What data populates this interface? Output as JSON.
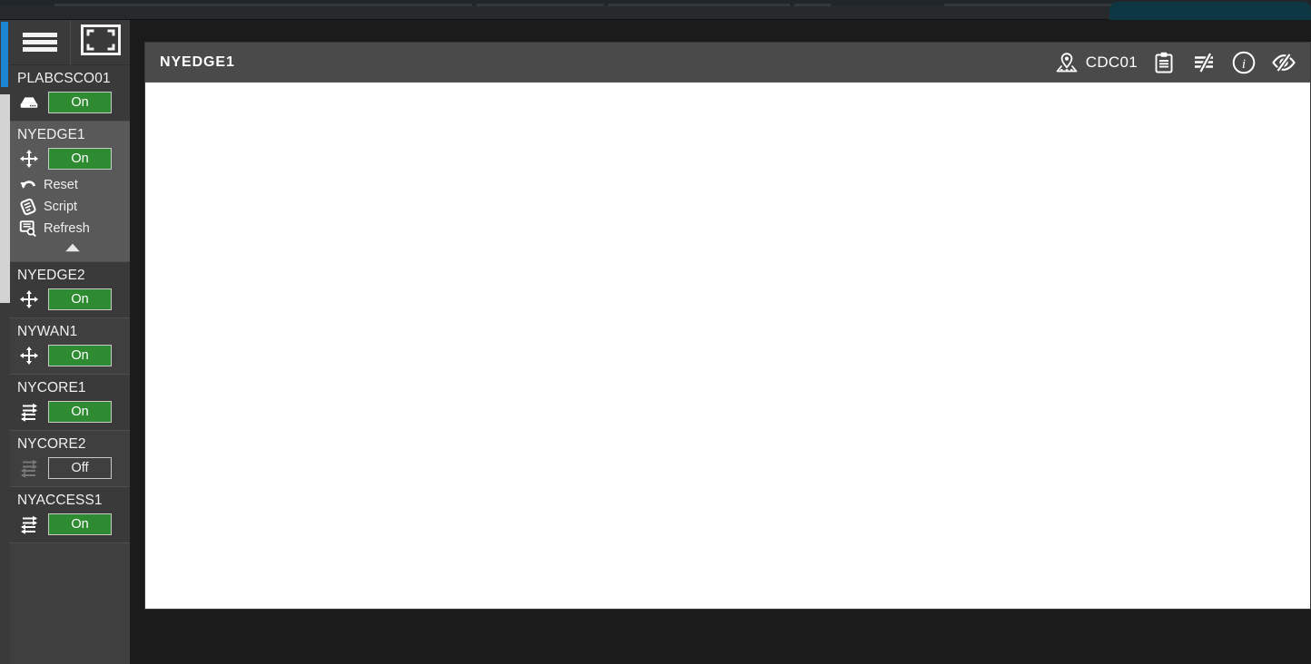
{
  "browser": {
    "tab_title": ""
  },
  "sidebar": {
    "toolbar": {
      "menu_label": "menu-toggle",
      "fullscreen_label": "fullscreen-toggle"
    },
    "devices": [
      {
        "name": "PLABCSCO01",
        "icon": "server-icon",
        "power_state": "On",
        "expanded": false,
        "actions": []
      },
      {
        "name": "NYEDGE1",
        "icon": "router-icon",
        "power_state": "On",
        "expanded": true,
        "actions": [
          {
            "label": "Reset",
            "icon": "undo-arrow-icon"
          },
          {
            "label": "Script",
            "icon": "scroll-icon"
          },
          {
            "label": "Refresh",
            "icon": "screen-search-icon"
          }
        ],
        "collapse_icon": "chevron-up-icon"
      },
      {
        "name": "NYEDGE2",
        "icon": "router-icon",
        "power_state": "On",
        "expanded": false,
        "actions": []
      },
      {
        "name": "NYWAN1",
        "icon": "router-icon",
        "power_state": "On",
        "expanded": false,
        "actions": []
      },
      {
        "name": "NYCORE1",
        "icon": "switch-icon",
        "power_state": "On",
        "expanded": false,
        "actions": []
      },
      {
        "name": "NYCORE2",
        "icon": "switch-icon",
        "power_state": "Off",
        "expanded": false,
        "actions": []
      },
      {
        "name": "NYACCESS1",
        "icon": "switch-icon",
        "power_state": "On",
        "expanded": false,
        "actions": []
      }
    ]
  },
  "main": {
    "title": "NYEDGE1",
    "site": {
      "icon": "map-pin-icon",
      "label": "CDC01"
    },
    "tools": [
      {
        "name": "clipboard-icon",
        "title": "Clipboard"
      },
      {
        "name": "lines-slash-icon",
        "title": "Toggle lines"
      },
      {
        "name": "info-circle-icon",
        "title": "Information"
      },
      {
        "name": "eye-slash-icon",
        "title": "Hide"
      }
    ]
  },
  "colors": {
    "accent_blue": "#1d86d4",
    "power_on_green": "#2e8b32",
    "panel_header": "#4a4a4a",
    "sidebar_bg": "#3f3f3f",
    "app_bg": "#1b1b1b",
    "canvas_bg": "#ffffff"
  }
}
